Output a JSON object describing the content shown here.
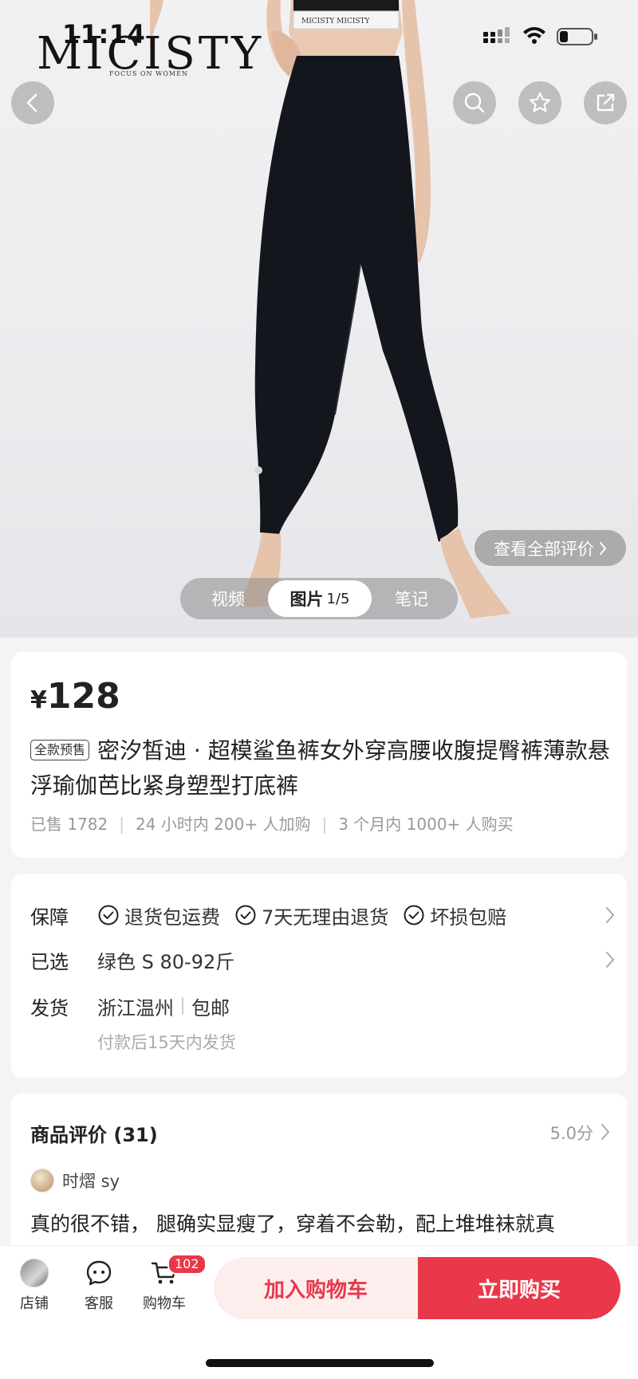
{
  "status_bar": {
    "time": "11:14"
  },
  "brand": {
    "name": "MICISTY",
    "tagline": "FOCUS ON WOMEN"
  },
  "header_icons": [
    "back-icon",
    "search-icon",
    "star-icon",
    "share-icon"
  ],
  "gallery": {
    "view_all_reviews": "查看全部评价",
    "tabs": [
      {
        "label": "视频"
      },
      {
        "label": "图片",
        "counter": "1/5"
      },
      {
        "label": "笔记"
      }
    ]
  },
  "product": {
    "currency": "¥",
    "price": "128",
    "presale_badge": "全款预售",
    "title": "密汐皙迪 · 超模鲨鱼裤女外穿高腰收腹提臀裤薄款悬浮瑜伽芭比紧身塑型打底裤",
    "sales": [
      "已售 1782",
      "24 小时内 200+ 人加购",
      "3 个月内 1000+ 人购买"
    ]
  },
  "info": {
    "guarantee_label": "保障",
    "guarantees": [
      "退货包运费",
      "7天无理由退货",
      "坏损包赔"
    ],
    "selected_label": "已选",
    "selected_value": "绿色 S 80-92斤",
    "shipping_label": "发货",
    "shipping_from": "浙江温州",
    "shipping_fee": "包邮",
    "shipping_note": "付款后15天内发货"
  },
  "reviews": {
    "title": "商品评价 (31)",
    "score": "5.0分",
    "reviewer": "时熠 sy",
    "text": "真的很不错，  腿确实显瘦了，穿着不会勒，配上堆堆袜就真"
  },
  "bottom_bar": {
    "shop_label": "店铺",
    "service_label": "客服",
    "cart_label": "购物车",
    "cart_count": "102",
    "add_to_cart": "加入购物车",
    "buy_now": "立即购买"
  },
  "colors": {
    "accent": "#e8384a",
    "accent_light": "#fdeeed",
    "page_bg": "#f4f4f6"
  }
}
